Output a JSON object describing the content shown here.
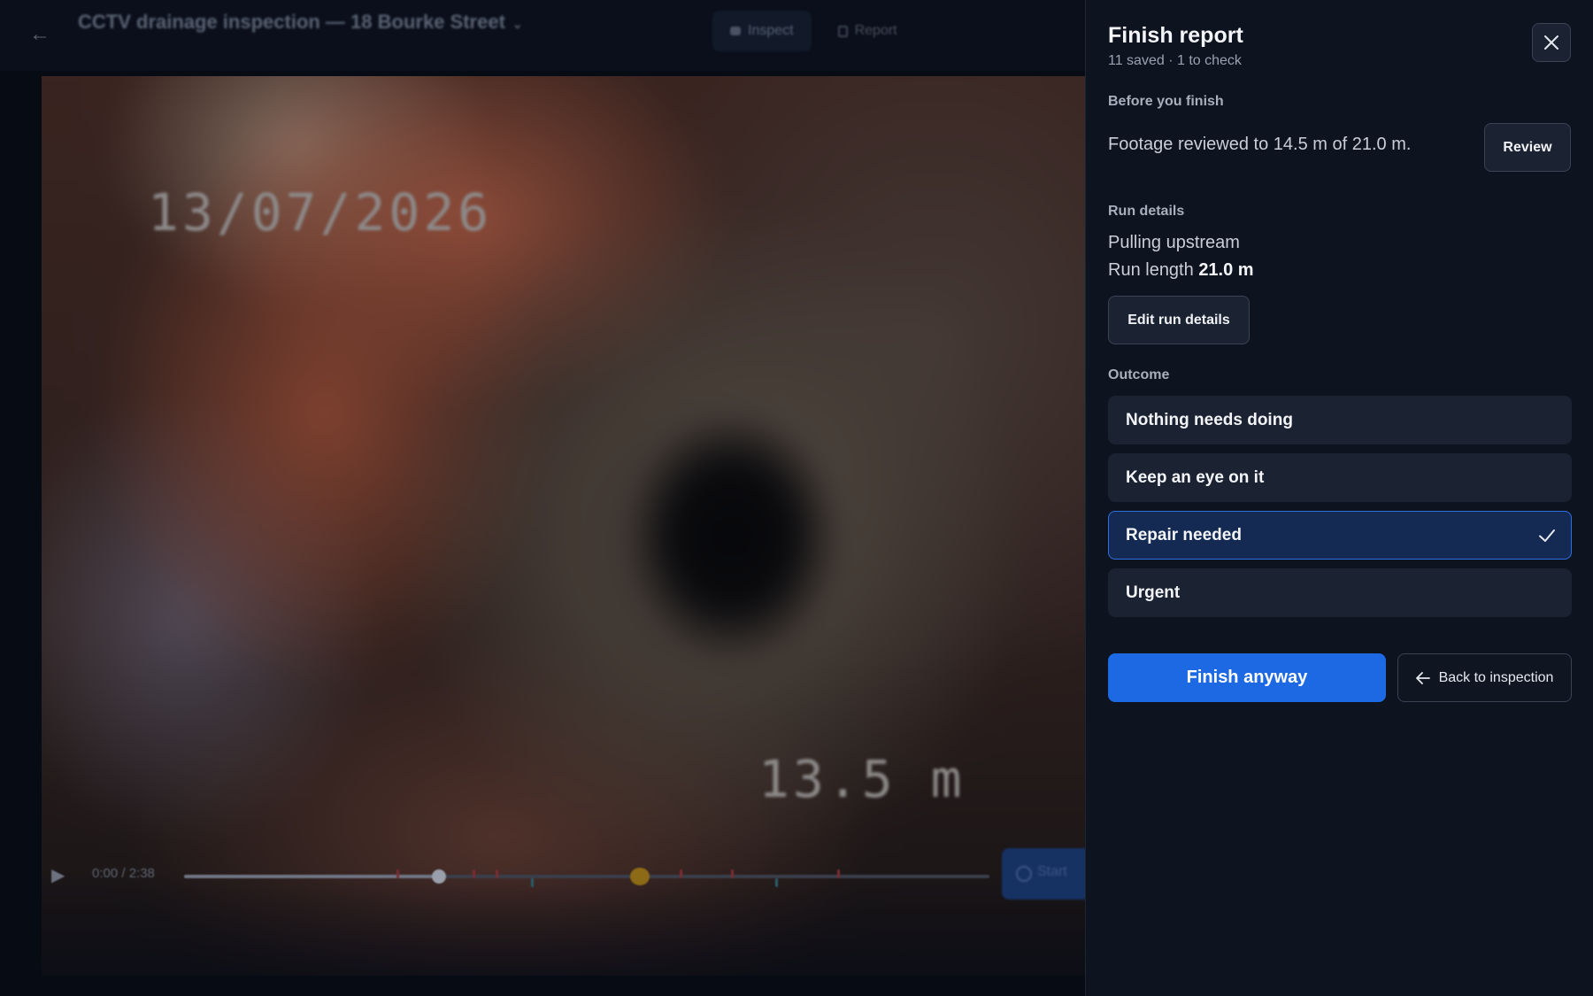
{
  "background": {
    "title": "CCTV drainage inspection — 18 Bourke Street",
    "subtitle": "",
    "tabs": [
      {
        "label": "Inspect",
        "icon": "camera-icon"
      },
      {
        "label": "Report",
        "icon": "document-icon"
      }
    ],
    "video": {
      "overlay_date": "13/07/2026",
      "overlay_distance": "13.5 m",
      "timecode": "0:00 / 2:38",
      "start_button_label": "Start"
    }
  },
  "drawer": {
    "title": "Finish report",
    "subtitle": "11 saved · 1 to check",
    "close_icon": "close-icon",
    "before_finish": {
      "label": "Before you finish",
      "text": "Footage reviewed to 14.5 m of 21.0 m.",
      "review_button": "Review"
    },
    "run_details": {
      "label": "Run details",
      "direction": "Pulling upstream",
      "length_prefix": "Run length",
      "length_value": "21.0 m",
      "edit_button": "Edit run details"
    },
    "outcome": {
      "label": "Outcome",
      "options": [
        {
          "label": "Nothing needs doing",
          "selected": false
        },
        {
          "label": "Keep an eye on it",
          "selected": false
        },
        {
          "label": "Repair needed",
          "selected": true
        },
        {
          "label": "Urgent",
          "selected": false
        }
      ]
    },
    "finish_button": "Finish anyway",
    "back_button": "Back to inspection"
  },
  "colors": {
    "accent": "#1d69e3",
    "selected_bg": "#142a53",
    "selected_border": "#2f6fe0",
    "drawer_bg": "#0d131f"
  }
}
